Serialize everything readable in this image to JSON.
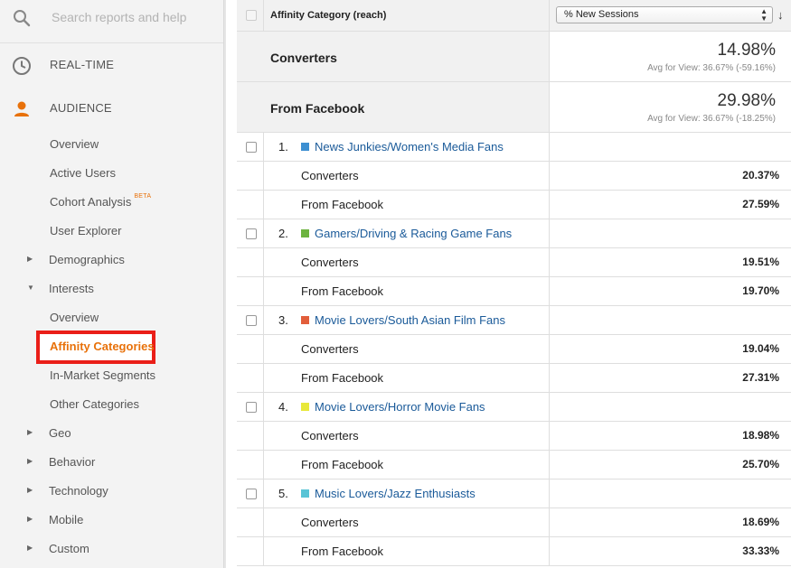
{
  "sidebar": {
    "search_placeholder": "Search reports and help",
    "realtime": "REAL-TIME",
    "audience": "AUDIENCE",
    "items": [
      {
        "label": "Overview"
      },
      {
        "label": "Active Users"
      },
      {
        "label": "Cohort Analysis",
        "badge": "BETA"
      },
      {
        "label": "User Explorer"
      },
      {
        "label": "Demographics"
      },
      {
        "label": "Interests"
      },
      {
        "label": "Overview"
      },
      {
        "label": "Affinity Categories"
      },
      {
        "label": "In-Market Segments"
      },
      {
        "label": "Other Categories"
      },
      {
        "label": "Geo"
      },
      {
        "label": "Behavior"
      },
      {
        "label": "Technology"
      },
      {
        "label": "Mobile"
      },
      {
        "label": "Custom"
      }
    ]
  },
  "table": {
    "header": {
      "dimension": "Affinity Category (reach)",
      "metric_select": "% New Sessions"
    },
    "segments": [
      {
        "name": "Converters",
        "value": "14.98%",
        "avg": "Avg for View: 36.67% (-59.16%)"
      },
      {
        "name": "From Facebook",
        "value": "29.98%",
        "avg": "Avg for View: 36.67% (-18.25%)"
      }
    ],
    "rows": [
      {
        "index": "1.",
        "name": "News Junkies/Women's Media Fans",
        "color": "#3d8fd1",
        "sub": [
          {
            "segment": "Converters",
            "value": "20.37%"
          },
          {
            "segment": "From Facebook",
            "value": "27.59%"
          }
        ]
      },
      {
        "index": "2.",
        "name": "Gamers/Driving & Racing Game Fans",
        "color": "#6cb33f",
        "sub": [
          {
            "segment": "Converters",
            "value": "19.51%"
          },
          {
            "segment": "From Facebook",
            "value": "19.70%"
          }
        ]
      },
      {
        "index": "3.",
        "name": "Movie Lovers/South Asian Film Fans",
        "color": "#e25e3b",
        "sub": [
          {
            "segment": "Converters",
            "value": "19.04%"
          },
          {
            "segment": "From Facebook",
            "value": "27.31%"
          }
        ]
      },
      {
        "index": "4.",
        "name": "Movie Lovers/Horror Movie Fans",
        "color": "#e8e83a",
        "sub": [
          {
            "segment": "Converters",
            "value": "18.98%"
          },
          {
            "segment": "From Facebook",
            "value": "25.70%"
          }
        ]
      },
      {
        "index": "5.",
        "name": "Music Lovers/Jazz Enthusiasts",
        "color": "#58c4d6",
        "sub": [
          {
            "segment": "Converters",
            "value": "18.69%"
          },
          {
            "segment": "From Facebook",
            "value": "33.33%"
          }
        ]
      }
    ]
  },
  "colors": {
    "accent": "#e8710a",
    "highlight_border": "#ea1e18",
    "link": "#1a5a99"
  }
}
